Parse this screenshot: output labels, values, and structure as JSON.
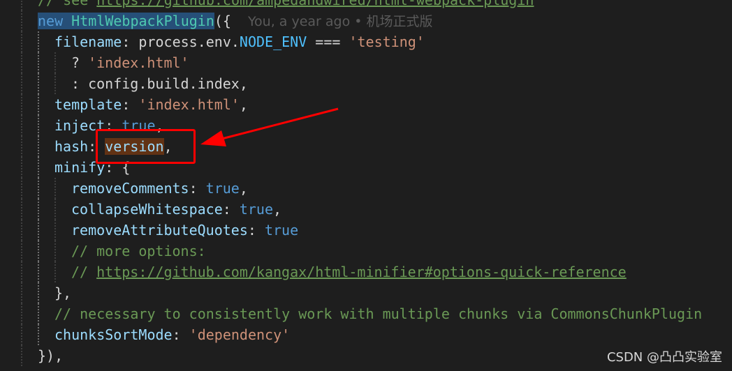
{
  "editor": {
    "blame": "You, a year ago • 机场正式版",
    "lines": [
      {
        "indent": 0,
        "guides": [],
        "tokens": [
          {
            "t": "// see ",
            "c": "c"
          },
          {
            "t": "https://github.com/ampedandwired/html-webpack-plugin",
            "c": "ln"
          }
        ]
      },
      {
        "indent": 0,
        "guides": [],
        "blame": true,
        "tokens": [
          {
            "t": "new",
            "c": "k hl-word"
          },
          {
            "t": " ",
            "c": "pn hl-word"
          },
          {
            "t": "HtmlWebpackPlugin",
            "c": "fn hl-word"
          },
          {
            "t": "({",
            "c": "pn"
          }
        ]
      },
      {
        "indent": 1,
        "guides": [
          1
        ],
        "tokens": [
          {
            "t": "filename",
            "c": "p"
          },
          {
            "t": ": process.env.",
            "c": "pn"
          },
          {
            "t": "NODE_ENV",
            "c": "cn"
          },
          {
            "t": " === ",
            "c": "pn"
          },
          {
            "t": "'testing'",
            "c": "s"
          }
        ]
      },
      {
        "indent": 2,
        "guides": [
          1,
          2
        ],
        "tokens": [
          {
            "t": "? ",
            "c": "pn"
          },
          {
            "t": "'index.html'",
            "c": "s"
          }
        ]
      },
      {
        "indent": 2,
        "guides": [
          1,
          2
        ],
        "tokens": [
          {
            "t": ": config.build.index,",
            "c": "pn"
          }
        ]
      },
      {
        "indent": 1,
        "guides": [
          1
        ],
        "tokens": [
          {
            "t": "template",
            "c": "p"
          },
          {
            "t": ": ",
            "c": "pn"
          },
          {
            "t": "'index.html'",
            "c": "s"
          },
          {
            "t": ",",
            "c": "pn"
          }
        ]
      },
      {
        "indent": 1,
        "guides": [
          1
        ],
        "tokens": [
          {
            "t": "inject",
            "c": "p"
          },
          {
            "t": ": ",
            "c": "pn"
          },
          {
            "t": "true",
            "c": "k"
          },
          {
            "t": ",",
            "c": "pn"
          }
        ]
      },
      {
        "indent": 1,
        "guides": [
          1
        ],
        "tokens": [
          {
            "t": "hash",
            "c": "p"
          },
          {
            "t": ": ",
            "c": "pn"
          },
          {
            "t": "version",
            "c": "p hl-ver"
          },
          {
            "t": ",",
            "c": "pn"
          }
        ]
      },
      {
        "indent": 1,
        "guides": [
          1
        ],
        "tokens": [
          {
            "t": "minify",
            "c": "p"
          },
          {
            "t": ": {",
            "c": "pn"
          }
        ]
      },
      {
        "indent": 2,
        "guides": [
          1,
          2
        ],
        "tokens": [
          {
            "t": "removeComments",
            "c": "p"
          },
          {
            "t": ": ",
            "c": "pn"
          },
          {
            "t": "true",
            "c": "k"
          },
          {
            "t": ",",
            "c": "pn"
          }
        ]
      },
      {
        "indent": 2,
        "guides": [
          1,
          2
        ],
        "tokens": [
          {
            "t": "collapseWhitespace",
            "c": "p"
          },
          {
            "t": ": ",
            "c": "pn"
          },
          {
            "t": "true",
            "c": "k"
          },
          {
            "t": ",",
            "c": "pn"
          }
        ]
      },
      {
        "indent": 2,
        "guides": [
          1,
          2
        ],
        "tokens": [
          {
            "t": "removeAttributeQuotes",
            "c": "p"
          },
          {
            "t": ": ",
            "c": "pn"
          },
          {
            "t": "true",
            "c": "k"
          }
        ]
      },
      {
        "indent": 2,
        "guides": [
          1,
          2
        ],
        "tokens": [
          {
            "t": "// more options:",
            "c": "c"
          }
        ]
      },
      {
        "indent": 2,
        "guides": [
          1,
          2
        ],
        "tokens": [
          {
            "t": "// ",
            "c": "c"
          },
          {
            "t": "https://github.com/kangax/html-minifier#options-quick-reference",
            "c": "ln"
          }
        ]
      },
      {
        "indent": 1,
        "guides": [
          1
        ],
        "tokens": [
          {
            "t": "},",
            "c": "pn"
          }
        ]
      },
      {
        "indent": 1,
        "guides": [
          1
        ],
        "tokens": [
          {
            "t": "// necessary to consistently work with multiple chunks via CommonsChunkPlugin",
            "c": "c"
          }
        ]
      },
      {
        "indent": 1,
        "guides": [
          1
        ],
        "tokens": [
          {
            "t": "chunksSortMode",
            "c": "p"
          },
          {
            "t": ": ",
            "c": "pn"
          },
          {
            "t": "'dependency'",
            "c": "s"
          }
        ]
      },
      {
        "indent": 0,
        "guides": [],
        "tokens": [
          {
            "t": "}),",
            "c": "pn"
          }
        ]
      }
    ]
  },
  "watermark": "CSDN @凸凸实验室",
  "annotation": {
    "box_color": "#ff0000",
    "arrow_color": "#ff0000"
  }
}
